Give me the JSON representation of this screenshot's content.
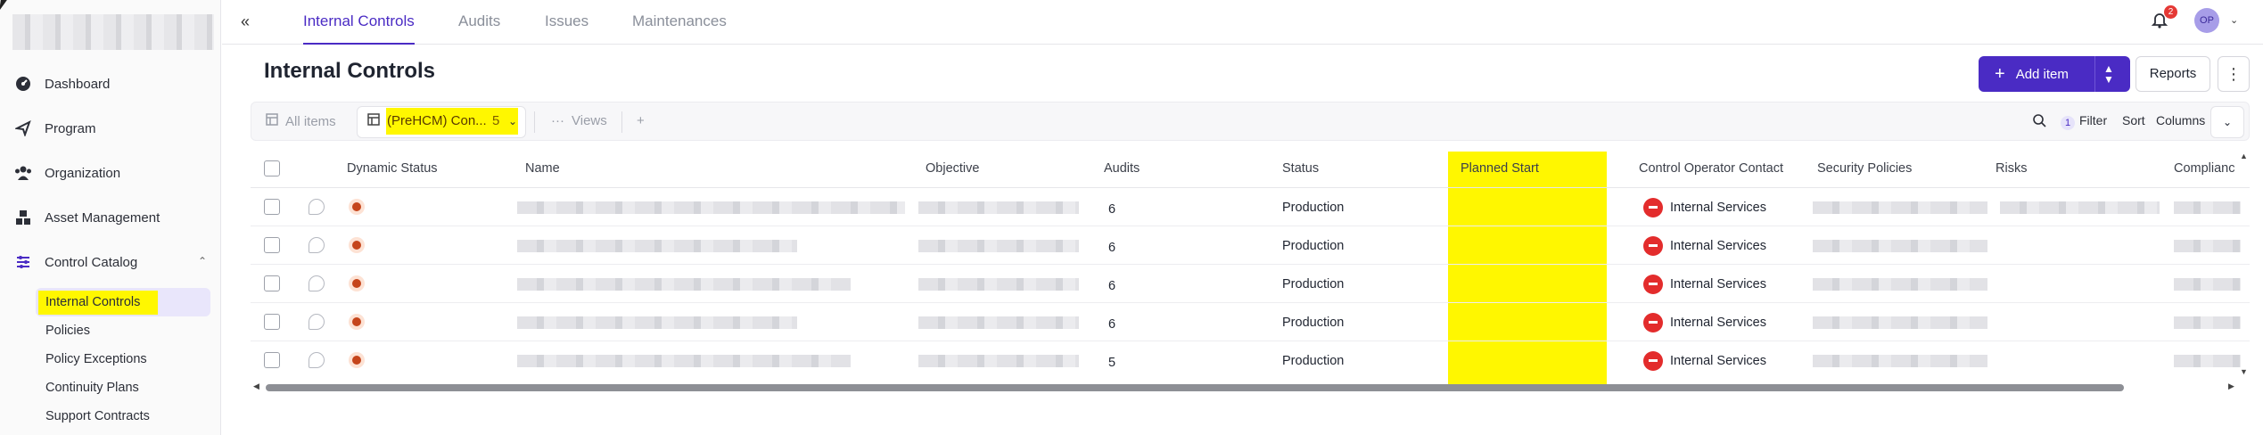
{
  "sidebar": {
    "nav": [
      {
        "label": "Dashboard",
        "icon": "dashboard-icon"
      },
      {
        "label": "Program",
        "icon": "program-icon"
      },
      {
        "label": "Organization",
        "icon": "organization-icon"
      },
      {
        "label": "Asset Management",
        "icon": "asset-management-icon"
      },
      {
        "label": "Control Catalog",
        "icon": "control-catalog-icon"
      }
    ],
    "sub": [
      "Internal Controls",
      "Policies",
      "Policy Exceptions",
      "Continuity Plans",
      "Support Contracts"
    ]
  },
  "tabs": [
    "Internal Controls",
    "Audits",
    "Issues",
    "Maintenances"
  ],
  "notifications": {
    "count": "2"
  },
  "user": {
    "initials": "OP"
  },
  "header": {
    "title": "Internal Controls",
    "add_label": "Add item",
    "reports_label": "Reports"
  },
  "toolbar": {
    "all_items": "All items",
    "view_name": "(PreHCM) Con...",
    "view_count": "5",
    "views": "Views",
    "filter_count": "1",
    "filter": "Filter",
    "sort": "Sort",
    "columns": "Columns"
  },
  "table": {
    "columns": [
      "Dynamic Status",
      "Name",
      "Objective",
      "Audits",
      "Status",
      "Planned Start",
      "Control Operator Contact",
      "Security Policies",
      "Risks",
      "Complianc"
    ],
    "rows": [
      {
        "audits": "6",
        "status": "Production",
        "operator": "Internal Services"
      },
      {
        "audits": "6",
        "status": "Production",
        "operator": "Internal Services"
      },
      {
        "audits": "6",
        "status": "Production",
        "operator": "Internal Services"
      },
      {
        "audits": "6",
        "status": "Production",
        "operator": "Internal Services"
      },
      {
        "audits": "5",
        "status": "Production",
        "operator": "Internal Services"
      }
    ]
  },
  "colors": {
    "accent": "#4a2bc4",
    "highlight": "#fff700",
    "status_icon": "#c5451b",
    "operator_icon": "#e32c2c"
  }
}
